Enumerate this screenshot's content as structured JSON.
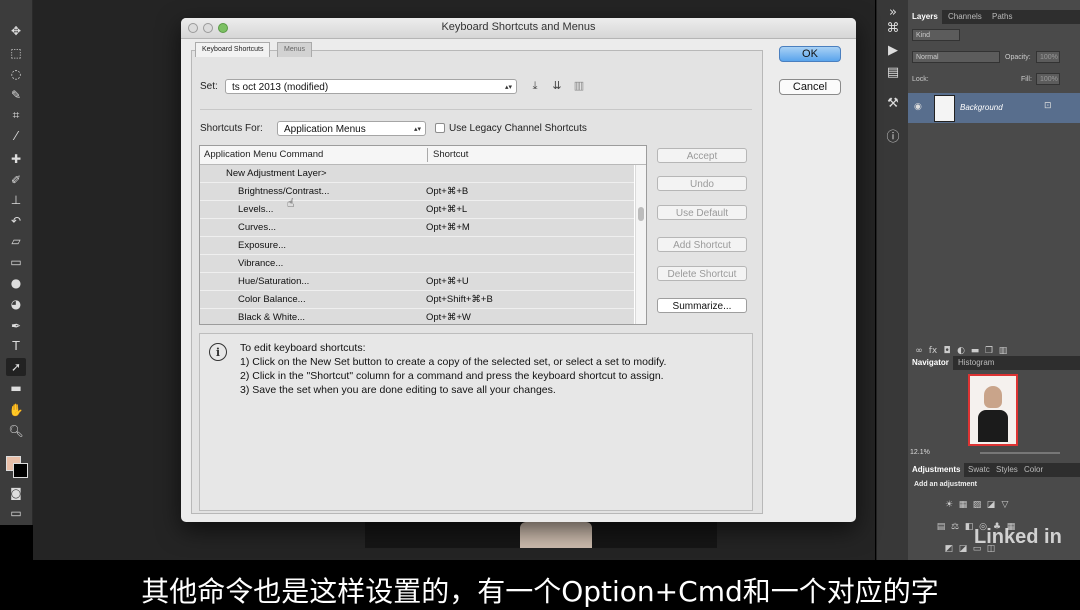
{
  "dialog": {
    "title": "Keyboard Shortcuts and Menus",
    "tabs": [
      "Keyboard Shortcuts",
      "Menus"
    ],
    "set_label": "Set:",
    "set_value": "ts oct 2013 (modified)",
    "shortcuts_for_label": "Shortcuts For:",
    "shortcuts_for_value": "Application Menus",
    "legacy_checkbox_label": "Use Legacy Channel Shortcuts",
    "legacy_checked": false,
    "table": {
      "headers": [
        "Application Menu Command",
        "Shortcut"
      ],
      "group": "New Adjustment Layer>",
      "rows": [
        {
          "command": "Brightness/Contrast...",
          "shortcut": "Opt+⌘+B"
        },
        {
          "command": "Levels...",
          "shortcut": "Opt+⌘+L"
        },
        {
          "command": "Curves...",
          "shortcut": "Opt+⌘+M"
        },
        {
          "command": "Exposure...",
          "shortcut": ""
        },
        {
          "command": "Vibrance...",
          "shortcut": ""
        },
        {
          "command": "Hue/Saturation...",
          "shortcut": "Opt+⌘+U"
        },
        {
          "command": "Color Balance...",
          "shortcut": "Opt+Shift+⌘+B"
        },
        {
          "command": "Black & White...",
          "shortcut": "Opt+⌘+W"
        }
      ]
    },
    "side_buttons": {
      "accept": "Accept",
      "undo": "Undo",
      "use_default": "Use Default",
      "add_shortcut": "Add Shortcut",
      "delete_shortcut": "Delete Shortcut",
      "summarize": "Summarize..."
    },
    "info": {
      "heading": "To edit keyboard shortcuts:",
      "step1": "1) Click on the New Set button to create a copy of the selected set, or select a set to modify.",
      "step2": "2) Click in the \"Shortcut\" column for a command and press the keyboard shortcut to assign.",
      "step3": "3) Save the set when you are done editing to save all your changes."
    },
    "ok": "OK",
    "cancel": "Cancel"
  },
  "layers_panel": {
    "tabs": [
      "Layers",
      "Channels",
      "Paths"
    ],
    "kind": "Kind",
    "blend_mode": "Normal",
    "opacity_label": "Opacity:",
    "opacity_value": "100%",
    "lock_label": "Lock:",
    "fill_label": "Fill:",
    "fill_value": "100%",
    "layer_name": "Background"
  },
  "navigator_panel": {
    "tabs": [
      "Navigator",
      "Histogram"
    ],
    "zoom": "12.1%"
  },
  "adjustments_panel": {
    "tabs": [
      "Adjustments",
      "Swatc",
      "Styles",
      "Color"
    ],
    "heading": "Add an adjustment"
  },
  "subtitle": "其他命令也是这样设置的，有一个Option+Cmd和一个对应的字",
  "watermark": "Linked in",
  "colors": {
    "dialog_bg": "#ececec",
    "ok_button": "#5aa4ec",
    "layer_selected": "#586e8d",
    "panel_bg": "#4a4a4a"
  }
}
